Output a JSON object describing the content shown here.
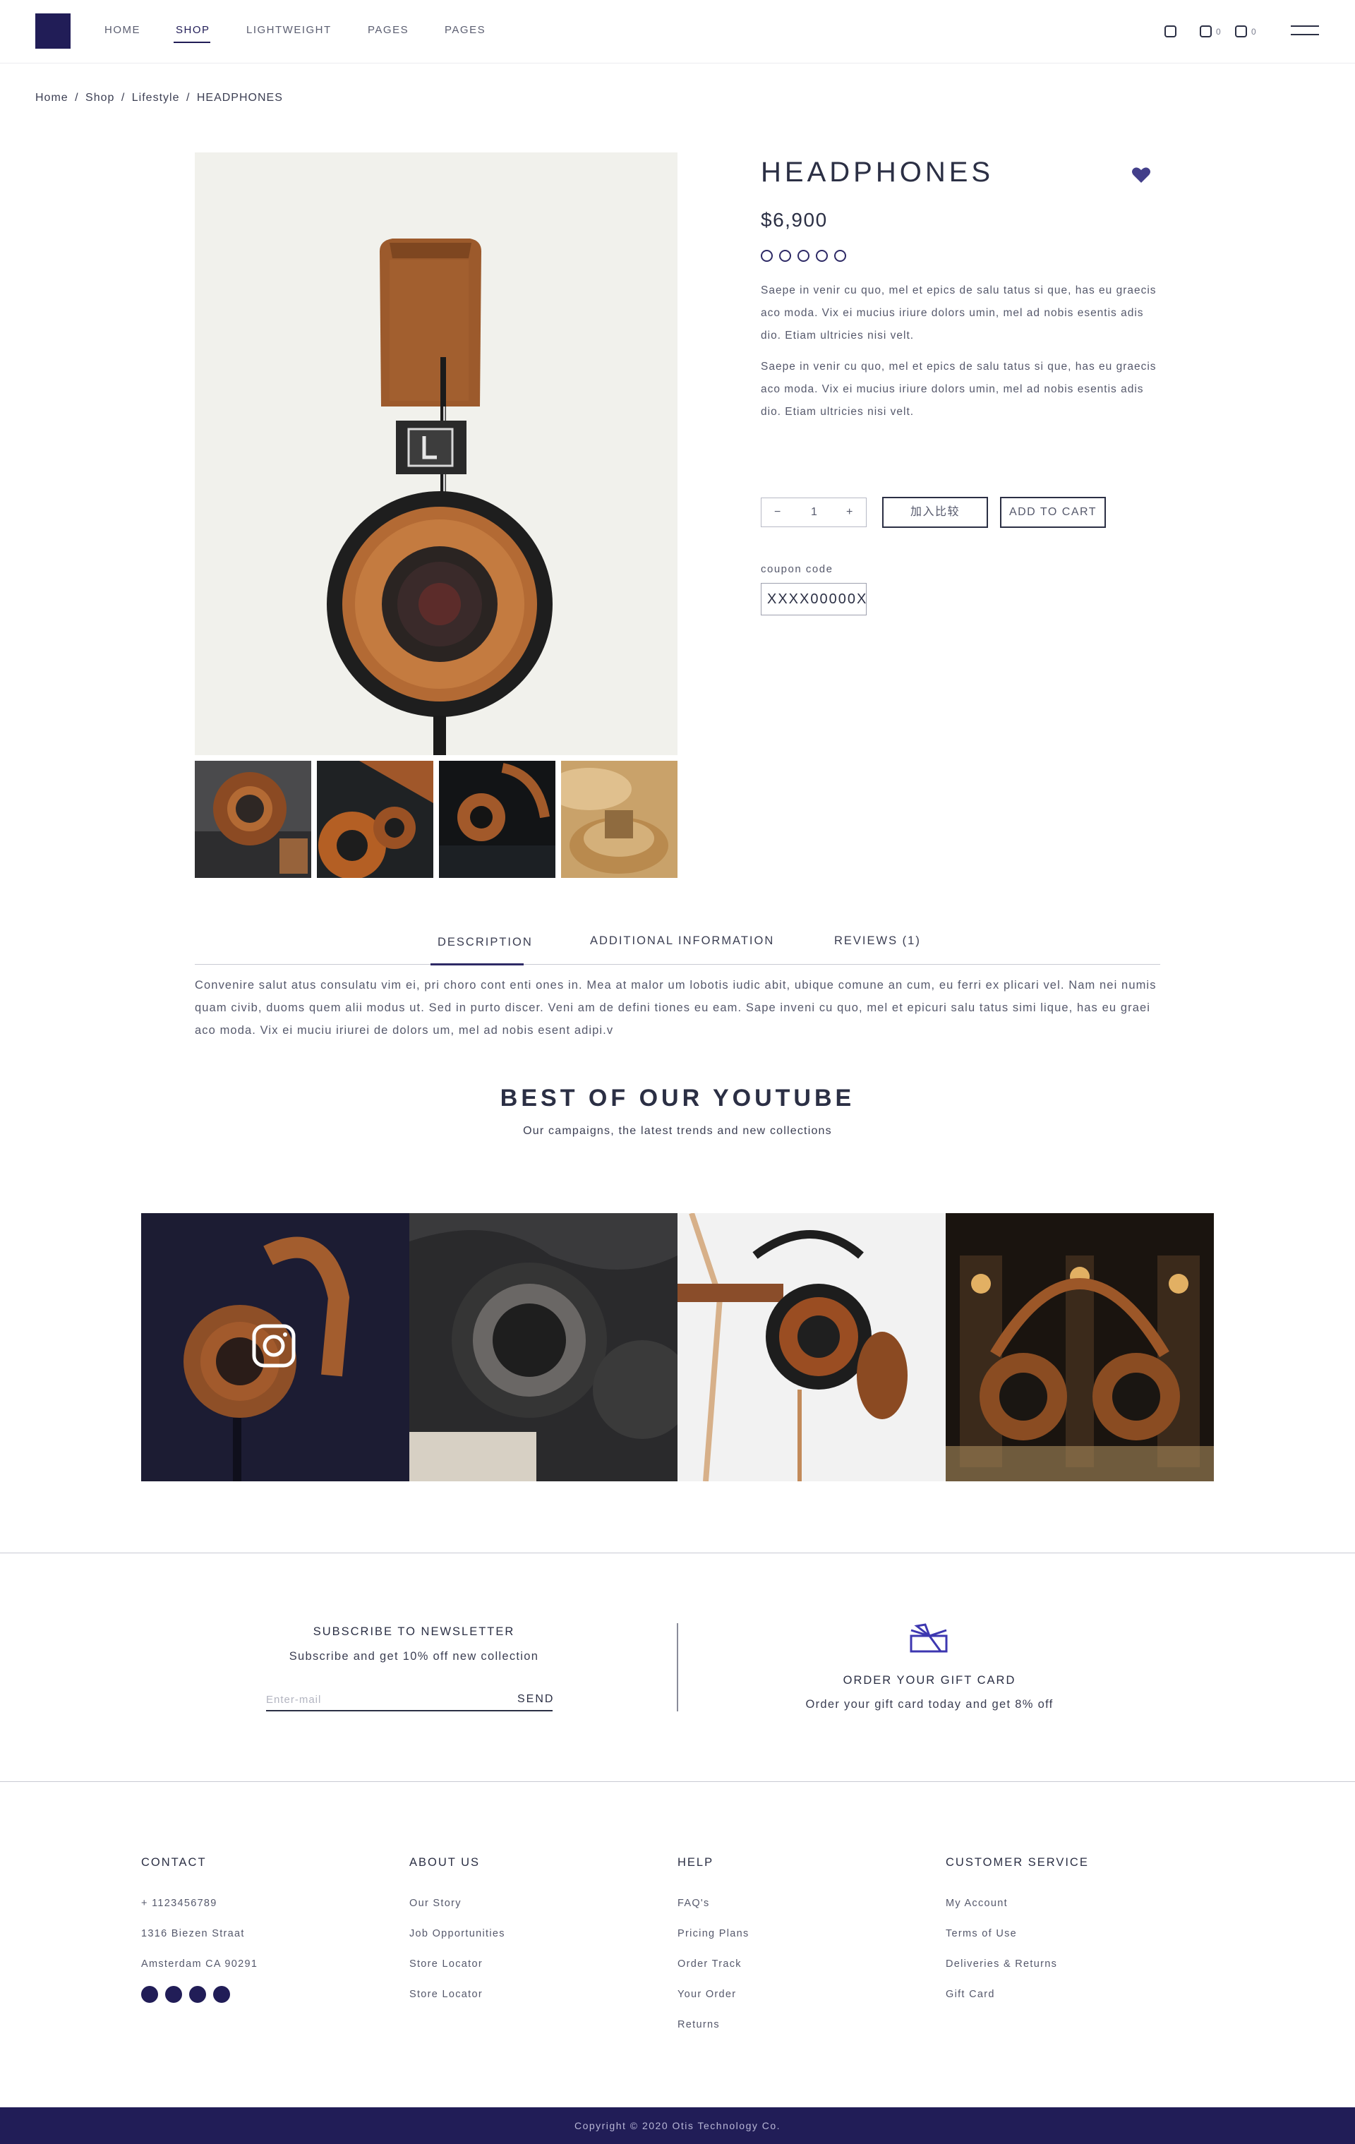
{
  "nav": {
    "items": [
      {
        "label": "HOME"
      },
      {
        "label": "SHOP"
      },
      {
        "label": "LIGHTWEIGHT"
      },
      {
        "label": "PAGES"
      },
      {
        "label": "PAGES"
      }
    ],
    "active": "SHOP",
    "icons": [
      "search-icon",
      "wishlist-icon",
      "cart-icon",
      "menu-icon"
    ],
    "wishlist_count": "0",
    "cart_count": "0"
  },
  "breadcrumb": [
    "Home",
    "/",
    "Shop",
    "/",
    "Lifestyle",
    "/",
    "HEADPHONES"
  ],
  "product": {
    "title": "HEADPHONES",
    "price": "$6,900",
    "rating": 0,
    "rating_max": 5,
    "description": [
      "Saepe in venir cu quo, mel et epics de salu tatus si que, has eu graecis aco moda. Vix ei mucius iriure dolors umin, mel ad nobis esentis adis dio. Etiam ultricies nisi velt.",
      "Saepe in venir cu quo, mel et epics de salu tatus si que, has eu graecis aco moda. Vix ei mucius iriure dolors umin, mel ad nobis esentis adis dio. Etiam ultricies nisi velt."
    ],
    "quantity": "1",
    "qty_minus": "−",
    "qty_plus": "+",
    "compare_label": "加入比较",
    "add_to_cart_label": "ADD TO CART",
    "coupon_label": "coupon code",
    "coupon_value": "XXXX00000X",
    "accent_color": "#2e2a66"
  },
  "tabs": {
    "items": [
      "DESCRIPTION",
      "ADDITIONAL INFORMATION",
      "REVIEWS (1)"
    ],
    "active": "DESCRIPTION",
    "content": "Convenire salut atus consulatu vim ei, pri choro cont enti ones in. Mea at malor um lobotis iudic abit, ubique comune an cum, eu ferri ex plicari vel. Nam nei numis quam civib, duoms quem alii modus ut. Sed in purto discer. Veni am de defini tiones eu eam. Sape inveni cu quo, mel et epicuri salu tatus simi lique, has eu graei aco moda. Vix ei muciu iriurei de dolors um, mel ad nobis esent adipi.v"
  },
  "youtube": {
    "title": "BEST OF OUR YOUTUBE",
    "subtitle": "Our campaigns, the latest trends and new collections"
  },
  "newsletter": {
    "title": "SUBSCRIBE TO NEWSLETTER",
    "subtitle": "Subscribe and get 10% off new collection",
    "placeholder": "Enter-mail",
    "send_label": "SEND"
  },
  "gift_card": {
    "icon": "gift-icon",
    "title": "ORDER YOUR GIFT CARD",
    "subtitle": "Order your gift card today and get 8% off"
  },
  "footer": {
    "columns": [
      {
        "heading": "CONTACT",
        "links": [
          "+ 1123456789",
          "1316 Biezen Straat",
          "Amsterdam CA 90291"
        ]
      },
      {
        "heading": "ABOUT US",
        "links": [
          "Our Story",
          "Job Opportunities",
          "Store Locator",
          "Store Locator"
        ]
      },
      {
        "heading": "HELP",
        "links": [
          "FAQ's",
          "Pricing Plans",
          "Order Track",
          "Your Order",
          "Returns"
        ]
      },
      {
        "heading": "CUSTOMER SERVICE",
        "links": [
          "My Account",
          "Terms of Use",
          "Deliveries & Returns",
          "Gift Card"
        ]
      }
    ],
    "social_icons": [
      "facebook-icon",
      "twitter-icon",
      "instagram-icon",
      "pinterest-icon"
    ],
    "copyright": "Copyright © 2020 Otis Technology Co.",
    "brand_color": "#211d57"
  }
}
